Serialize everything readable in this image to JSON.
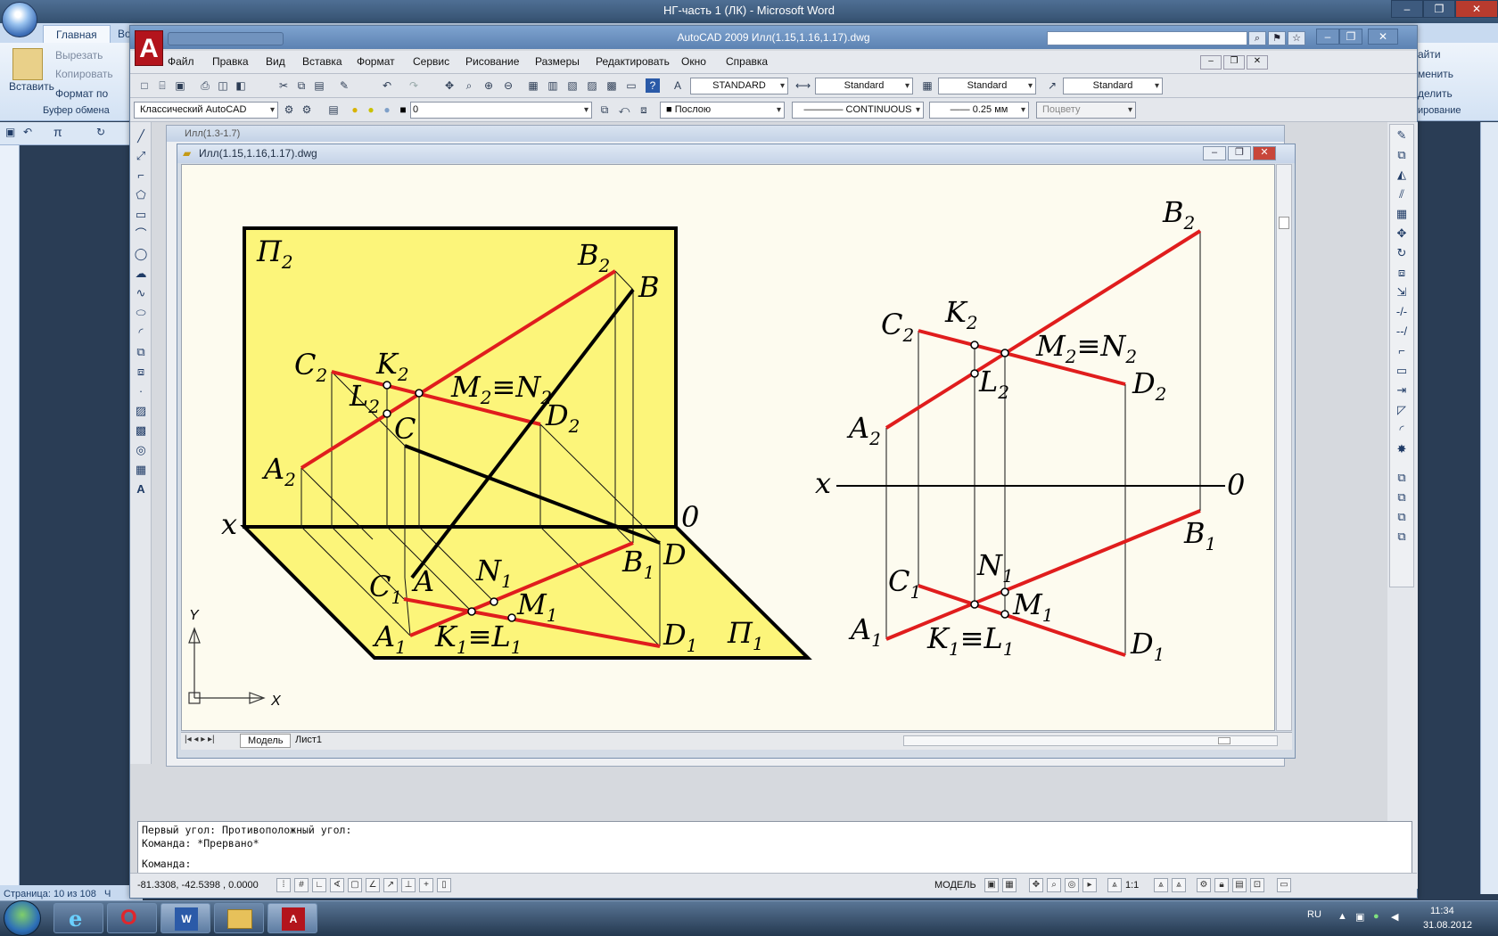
{
  "word": {
    "title": "НГ-часть 1 (ЛК) - Microsoft Word",
    "tabs": [
      "Главная",
      "Во"
    ],
    "ribbon": {
      "paste": "Вставить",
      "cut": "Вырезать",
      "copy": "Копировать",
      "format_painter": "Формат по",
      "group": "Буфер обмена",
      "right1": "айти",
      "right2": "менить",
      "right3": "делить",
      "right4": "ирование"
    },
    "status_page": "Страница: 10 из 108",
    "status_tail": "Ч"
  },
  "autocad": {
    "title": "AutoCAD 2009 Илл(1.15,1.16,1.17).dwg",
    "menu": [
      "Файл",
      "Правка",
      "Вид",
      "Вставка",
      "Формат",
      "Сервис",
      "Рисование",
      "Размеры",
      "Редактировать",
      "Окно",
      "Справка"
    ],
    "toolbar1": {
      "text_style": "STANDARD",
      "dim_style": "Standard",
      "table_style": "Standard",
      "multileader_style": "Standard"
    },
    "toolbar2": {
      "workspace": "Классический AutoCAD",
      "layer": "0",
      "color": "Послою",
      "linetype": "CONTINUOUS",
      "lineweight": "0.25 мм",
      "plotstyle": "Поцвету"
    },
    "bg_doc_title": "Илл(1.3-1.7)",
    "doc_title": "Илл(1.15,1.16,1.17).dwg",
    "layout_tabs": [
      "Модель",
      "Лист1"
    ],
    "command_lines": [
      "Первый угол: Противоположный угол:",
      "Команда: *Прервано*",
      "Команда:"
    ],
    "coords": "-81.3308, -42.5398 , 0.0000",
    "status_model": "МОДЕЛЬ",
    "scale": "1:1",
    "ucs": {
      "x": "X",
      "y": "Y"
    }
  },
  "drawing": {
    "left": {
      "p2": [
        "П",
        "2"
      ],
      "p1": [
        "П",
        "1"
      ],
      "x": "x",
      "zero": "0",
      "B2": [
        "B",
        "2"
      ],
      "B": [
        "B",
        ""
      ],
      "C2": [
        "C",
        "2"
      ],
      "K2": [
        "K",
        "2"
      ],
      "L2": [
        "L",
        "2"
      ],
      "C": [
        "C",
        ""
      ],
      "MN2": [
        "M",
        "2",
        "≡N",
        "2"
      ],
      "D2": [
        "D",
        "2"
      ],
      "A2": [
        "A",
        "2"
      ],
      "D": [
        "D",
        ""
      ],
      "B1": [
        "B",
        "1"
      ],
      "C1": [
        "C",
        "1"
      ],
      "A": [
        "A",
        ""
      ],
      "N1": [
        "N",
        "1"
      ],
      "M1": [
        "M",
        "1"
      ],
      "A1": [
        "A",
        "1"
      ],
      "KL1": [
        "K",
        "1",
        "≡L",
        "1"
      ],
      "D1": [
        "D",
        "1"
      ]
    },
    "right": {
      "x": "x",
      "zero": "0",
      "B2": [
        "B",
        "2"
      ],
      "C2": [
        "C",
        "2"
      ],
      "K2": [
        "K",
        "2"
      ],
      "MN2": [
        "M",
        "2",
        "≡N",
        "2"
      ],
      "L2": [
        "L",
        "2"
      ],
      "D2": [
        "D",
        "2"
      ],
      "A2": [
        "A",
        "2"
      ],
      "B1": [
        "B",
        "1"
      ],
      "N1": [
        "N",
        "1"
      ],
      "C1": [
        "C",
        "1"
      ],
      "M1": [
        "M",
        "1"
      ],
      "A1": [
        "A",
        "1"
      ],
      "KL1": [
        "K",
        "1",
        "≡L",
        "1"
      ],
      "D1": [
        "D",
        "1"
      ]
    }
  },
  "taskbar": {
    "lang": "RU",
    "time": "11:34",
    "date": "31.08.2012"
  },
  "colors": {
    "plane_fill": "#fcf57a",
    "red_line": "#e01d1d",
    "canvas": "#fdfbef"
  }
}
